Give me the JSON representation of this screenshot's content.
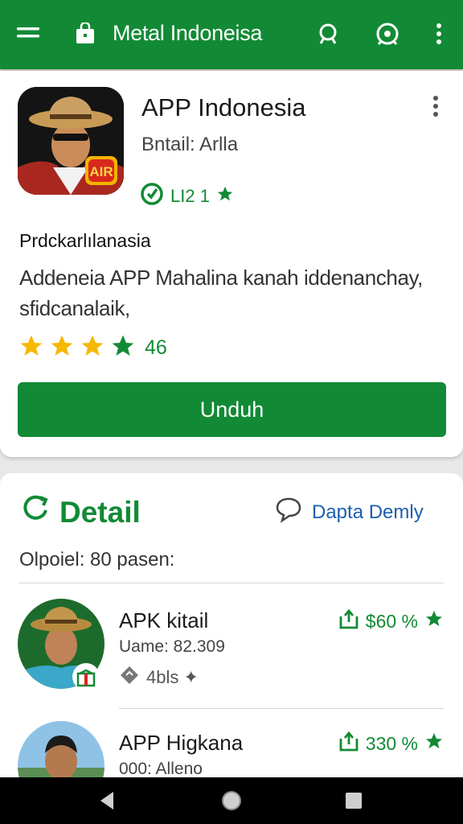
{
  "appbar": {
    "title": "Metal Indoneisa",
    "color": "#128a35"
  },
  "app": {
    "name": "APP Indonesia",
    "subtitle": "Bntail: Arlla",
    "meta": "LI2 1",
    "heading": "Prdckarlılanasia",
    "description": "Addeneia APP Mahalina kanah iddenanchay, sfidcanalaik,",
    "rating_count": "46",
    "rating_value": 4,
    "download_label": "Unduh"
  },
  "detail": {
    "title": "Detail",
    "link_label": "Dapta Demly",
    "subline": "Olpoiel: 80 pasen:",
    "items": [
      {
        "name": "APK kitail",
        "sub": "Uame: 82.309",
        "tag": "4bls ✦",
        "price": "$60 %"
      },
      {
        "name": "APP Higkana",
        "sub": "000: Alleno",
        "price": "330 %"
      }
    ]
  },
  "colors": {
    "accent": "#128a35",
    "link": "#1d5fb0",
    "star": "#f6b800"
  },
  "icons": [
    "menu-icon",
    "bag-icon",
    "search-icon",
    "share-icon",
    "more-vert-icon",
    "star-icon",
    "back-icon",
    "home-icon",
    "recents-icon"
  ]
}
